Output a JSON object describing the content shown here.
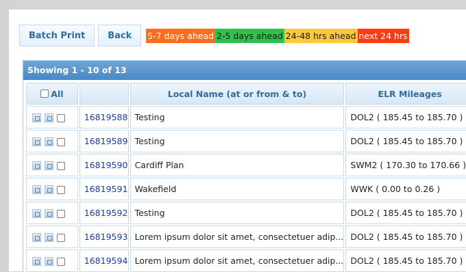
{
  "toolbar": {
    "batch_print": "Batch Print",
    "back": "Back"
  },
  "legend": [
    {
      "label": "5-7 days ahead",
      "color": "#ff6d1a"
    },
    {
      "label": "2-5 days ahead",
      "color": "#2fc24a"
    },
    {
      "label": "24-48 hrs ahead",
      "color": "#ffc83a"
    },
    {
      "label": "next 24 hrs",
      "color": "#ff3b14"
    }
  ],
  "grid": {
    "title": "Showing 1 - 10 of 13",
    "columns": {
      "select_all": "All",
      "id": "",
      "local_name": "Local Name (at or from & to)",
      "elr": "ELR Mileages"
    },
    "rows": [
      {
        "id": "16819588",
        "name": "Testing",
        "elr": "DOL2 ( 185.45 to 185.70 )"
      },
      {
        "id": "16819589",
        "name": "Testing",
        "elr": "DOL2 ( 185.45 to 185.70 )"
      },
      {
        "id": "16819590",
        "name": "Cardiff Plan",
        "elr": "SWM2 ( 170.30 to 170.66 )"
      },
      {
        "id": "16819591",
        "name": "Wakefield",
        "elr": "WWK ( 0.00 to 0.26 )"
      },
      {
        "id": "16819592",
        "name": "Testing",
        "elr": "DOL2 ( 185.45 to 185.70 )"
      },
      {
        "id": "16819593",
        "name": "Lorem ipsum dolor sit amet, consectetuer adip...",
        "elr": "DOL2 ( 185.45 to 185.70 )"
      },
      {
        "id": "16819594",
        "name": "Lorem ipsum dolor sit amet, consectetuer adip...",
        "elr": "DOL2 ( 185.45 to 185.70 )"
      }
    ]
  }
}
